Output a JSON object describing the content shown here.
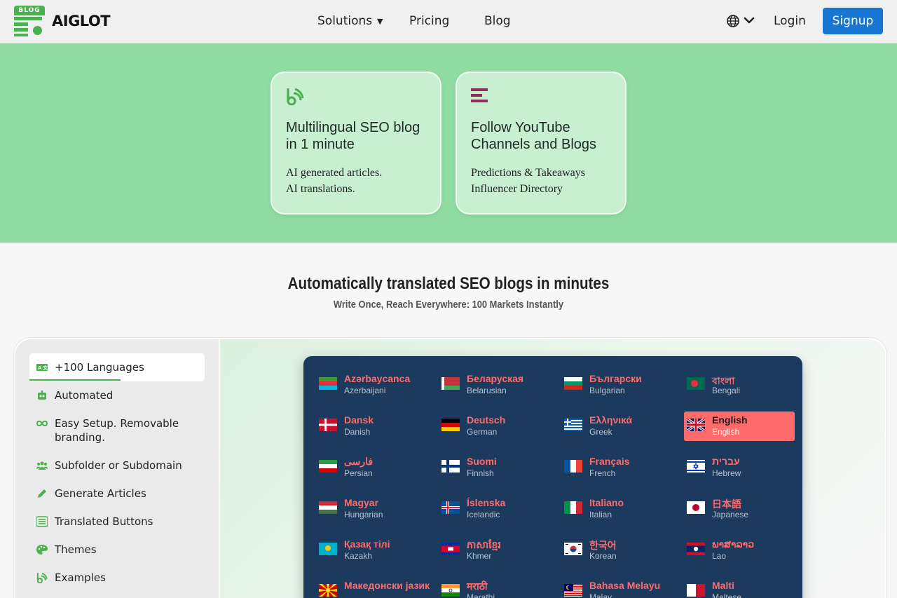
{
  "header": {
    "logo_badge": "BLOG",
    "logo_text": "AIGLOT",
    "nav": [
      {
        "label": "Solutions",
        "has_dropdown": true
      },
      {
        "label": "Pricing"
      },
      {
        "label": "Blog"
      }
    ],
    "language_icon": "globe-icon",
    "login_label": "Login",
    "signup_label": "Signup"
  },
  "hero": {
    "cards": [
      {
        "icon": "blog-feed-icon",
        "title": "Multilingual SEO blog in 1 minute",
        "lines": [
          "AI generated articles.",
          "AI translations."
        ]
      },
      {
        "icon": "stacked-bars-icon",
        "title": "Follow YouTube Channels and Blogs",
        "lines": [
          "Predictions & Takeaways",
          "Influencer Directory"
        ]
      }
    ]
  },
  "section": {
    "title": "Automatically translated SEO blogs in minutes",
    "subtitle": "Write Once, Reach Everywhere: 100 Markets Instantly"
  },
  "features": [
    {
      "icon": "translate-icon",
      "label": "+100 Languages",
      "active": true
    },
    {
      "icon": "robot-icon",
      "label": "Automated"
    },
    {
      "icon": "infinity-icon",
      "label": "Easy Setup. Removable branding."
    },
    {
      "icon": "users-icon",
      "label": "Subfolder or Subdomain"
    },
    {
      "icon": "pencil-icon",
      "label": "Generate Articles"
    },
    {
      "icon": "list-icon",
      "label": "Translated Buttons"
    },
    {
      "icon": "palette-icon",
      "label": "Themes"
    },
    {
      "icon": "blog-feed-icon",
      "label": "Examples"
    }
  ],
  "languages": [
    {
      "native": "Azərbaycanca",
      "english": "Azerbaijani",
      "flag": "az"
    },
    {
      "native": "Беларуская",
      "english": "Belarusian",
      "flag": "by"
    },
    {
      "native": "Български",
      "english": "Bulgarian",
      "flag": "bg"
    },
    {
      "native": "বাংলা",
      "english": "Bengali",
      "flag": "bd"
    },
    {
      "native": "Dansk",
      "english": "Danish",
      "flag": "dk"
    },
    {
      "native": "Deutsch",
      "english": "German",
      "flag": "de"
    },
    {
      "native": "Ελληνικά",
      "english": "Greek",
      "flag": "gr"
    },
    {
      "native": "English",
      "english": "English",
      "flag": "gb",
      "selected": true
    },
    {
      "native": "فارسی",
      "english": "Persian",
      "flag": "ir"
    },
    {
      "native": "Suomi",
      "english": "Finnish",
      "flag": "fi"
    },
    {
      "native": "Français",
      "english": "French",
      "flag": "fr"
    },
    {
      "native": "עברית",
      "english": "Hebrew",
      "flag": "il"
    },
    {
      "native": "Magyar",
      "english": "Hungarian",
      "flag": "hu"
    },
    {
      "native": "Íslenska",
      "english": "Icelandic",
      "flag": "is"
    },
    {
      "native": "Italiano",
      "english": "Italian",
      "flag": "it"
    },
    {
      "native": "日本語",
      "english": "Japanese",
      "flag": "jp"
    },
    {
      "native": "Қазақ тілі",
      "english": "Kazakh",
      "flag": "kz"
    },
    {
      "native": "ភាសាខ្មែរ",
      "english": "Khmer",
      "flag": "kh"
    },
    {
      "native": "한국어",
      "english": "Korean",
      "flag": "kr"
    },
    {
      "native": "ພາສາລາວ",
      "english": "Lao",
      "flag": "la"
    },
    {
      "native": "Македонски јазик",
      "english": "",
      "flag": "mk"
    },
    {
      "native": "मराठी",
      "english": "Marathi",
      "flag": "in"
    },
    {
      "native": "Bahasa Melayu",
      "english": "Malay",
      "flag": "my"
    },
    {
      "native": "Malti",
      "english": "Maltese",
      "flag": "mt"
    }
  ],
  "colors": {
    "brand_green": "#4caf50",
    "hero_bg": "#8fdca3",
    "card_bg": "#c7efd0",
    "signup_blue": "#1976d2",
    "lang_box_bg": "#1c3a5e",
    "lang_accent": "#ff6b6b"
  }
}
